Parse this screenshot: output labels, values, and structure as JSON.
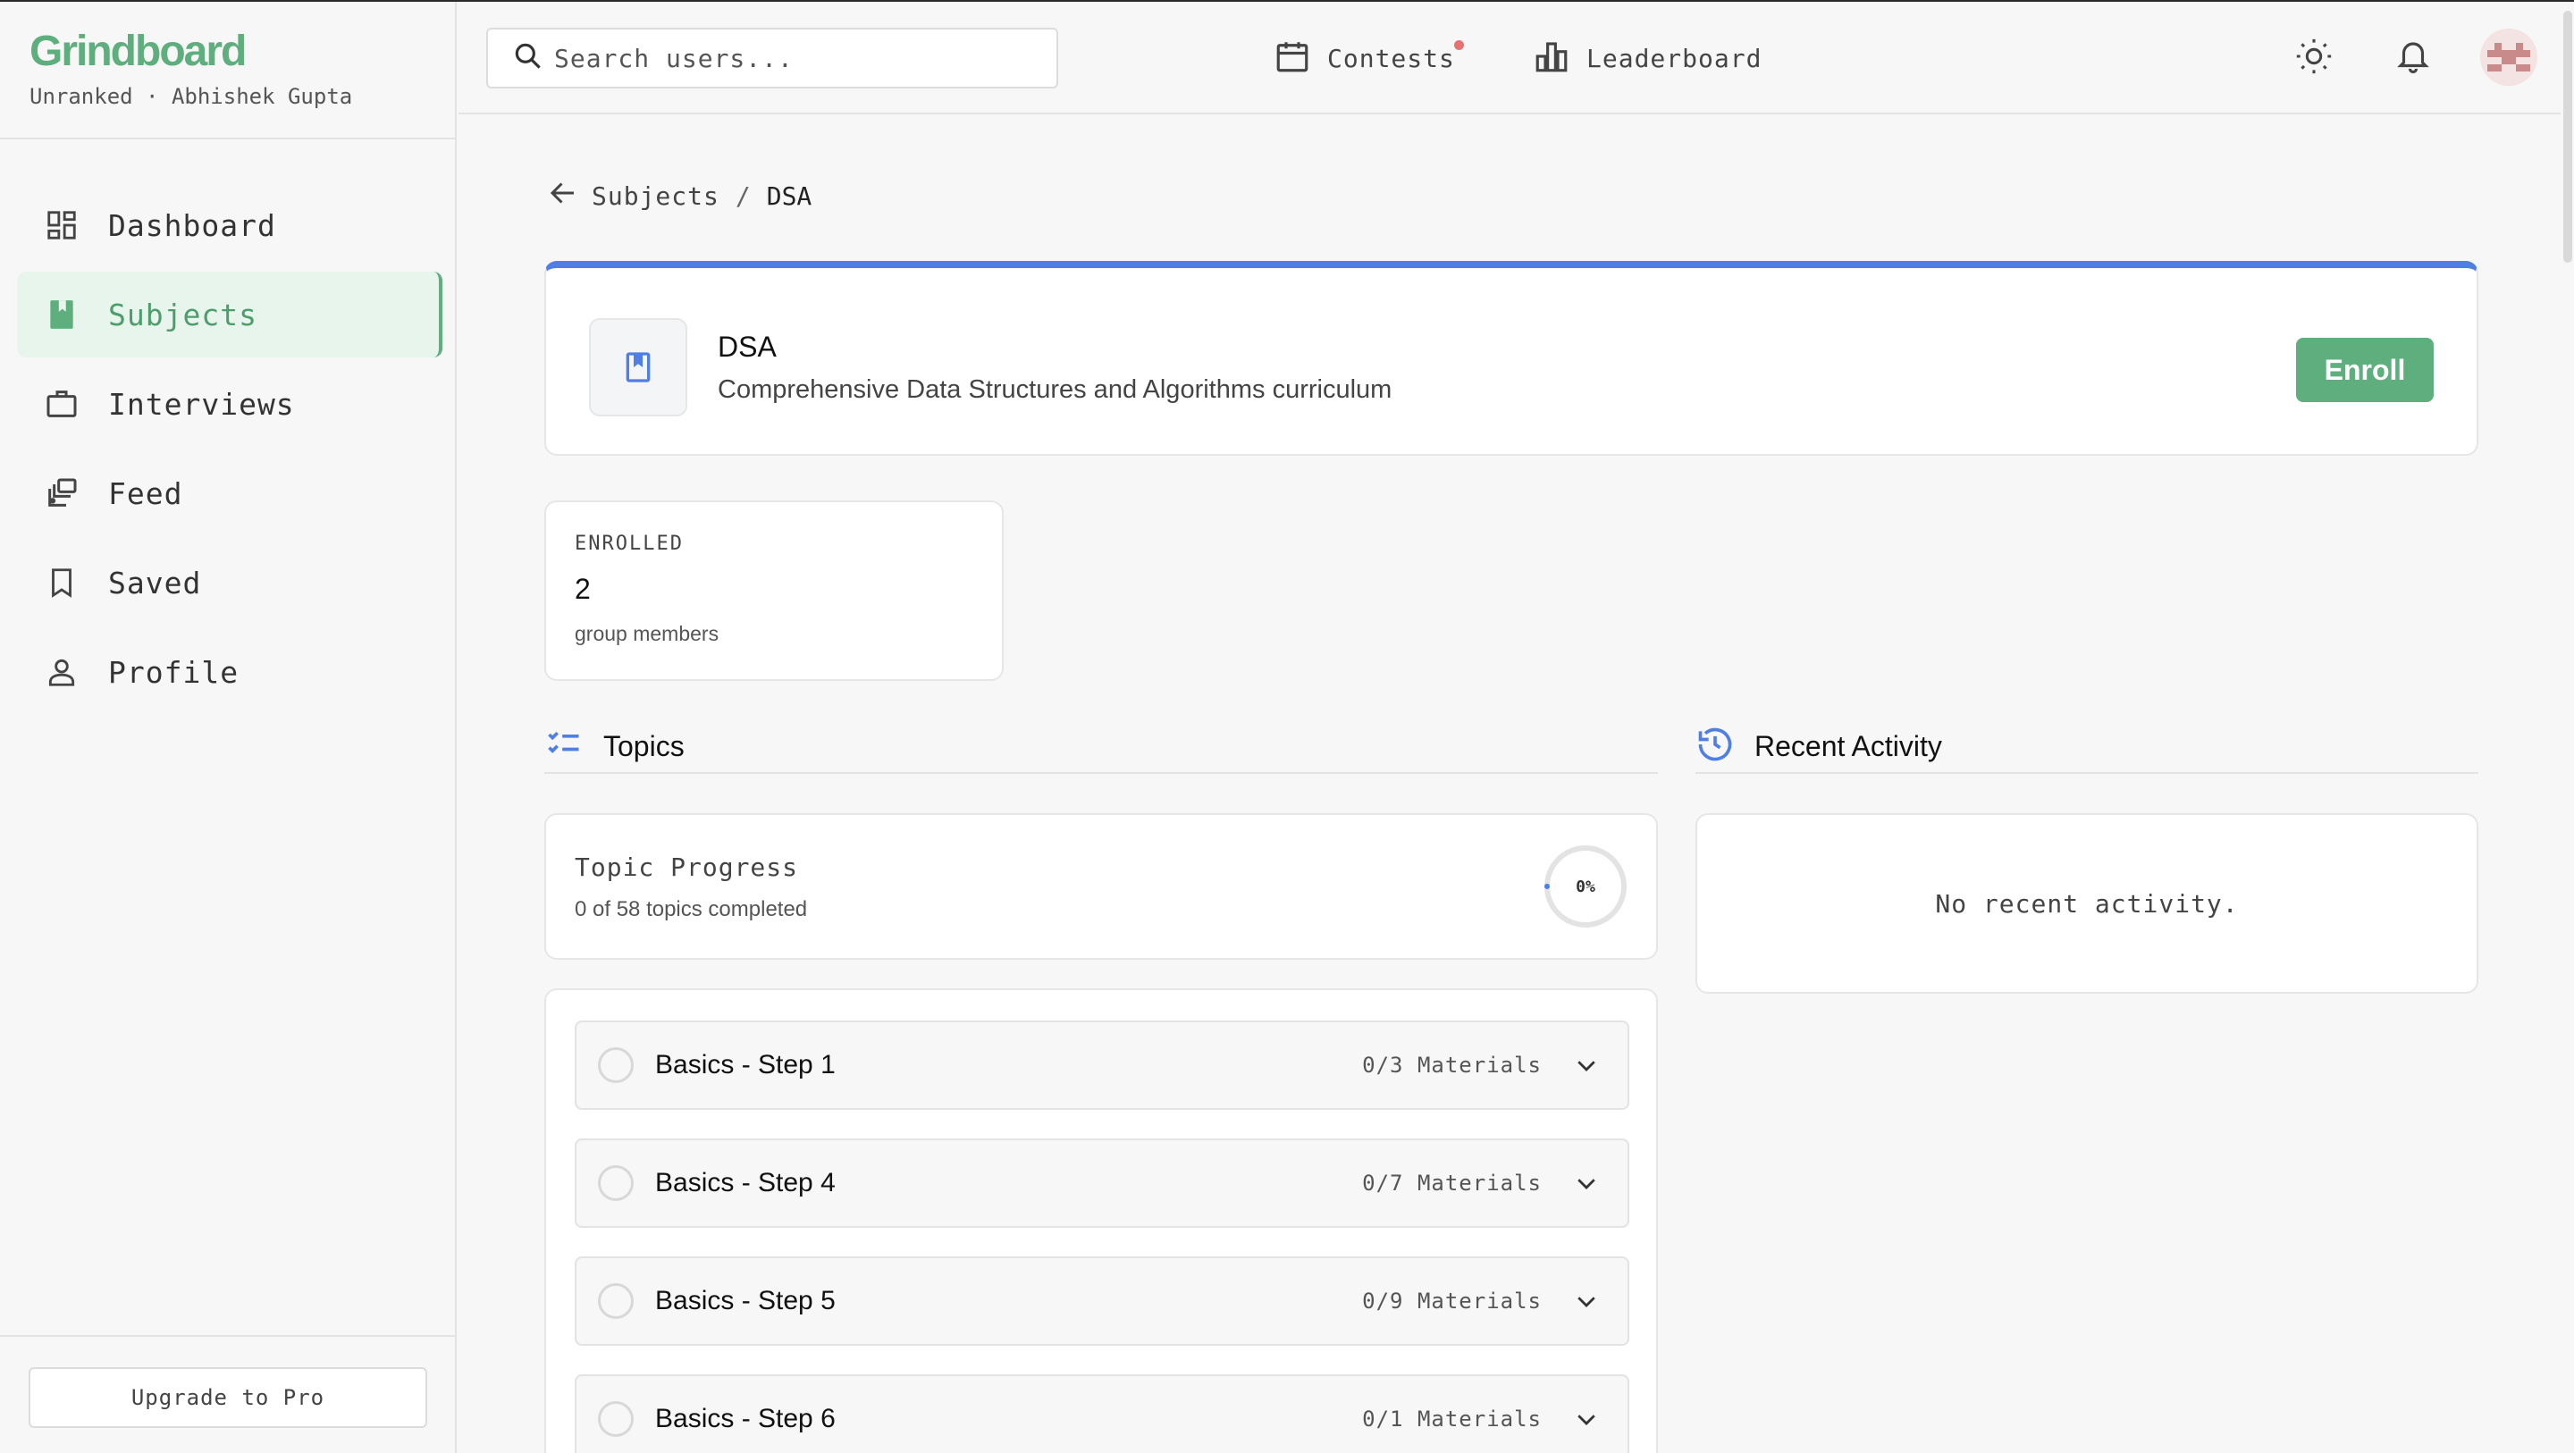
{
  "brand": {
    "name": "Grindboard",
    "subtitle": "Unranked · Abhishek Gupta"
  },
  "sidebar": {
    "items": [
      {
        "label": "Dashboard",
        "icon": "dashboard-icon"
      },
      {
        "label": "Subjects",
        "icon": "book-icon",
        "active": true
      },
      {
        "label": "Interviews",
        "icon": "briefcase-icon"
      },
      {
        "label": "Feed",
        "icon": "feed-icon"
      },
      {
        "label": "Saved",
        "icon": "bookmark-icon"
      },
      {
        "label": "Profile",
        "icon": "user-icon"
      }
    ],
    "upgrade_label": "Upgrade to Pro"
  },
  "topbar": {
    "search_placeholder": "Search users...",
    "contests_label": "Contests",
    "leaderboard_label": "Leaderboard"
  },
  "breadcrumb": {
    "parent": "Subjects",
    "separator": "/",
    "current": "DSA"
  },
  "subject": {
    "title": "DSA",
    "description": "Comprehensive Data Structures and Algorithms curriculum",
    "enroll_label": "Enroll"
  },
  "stat": {
    "label": "ENROLLED",
    "value": "2",
    "sub": "group members"
  },
  "topics": {
    "heading": "Topics",
    "progress_title": "Topic Progress",
    "progress_sub": "0 of 58 topics completed",
    "progress_percent_label": "0%",
    "progress_fraction": 0,
    "items": [
      {
        "name": "Basics - Step 1",
        "count": "0/3 Materials"
      },
      {
        "name": "Basics - Step 4",
        "count": "0/7 Materials"
      },
      {
        "name": "Basics - Step 5",
        "count": "0/9 Materials"
      },
      {
        "name": "Basics - Step 6",
        "count": "0/1 Materials"
      }
    ]
  },
  "activity": {
    "heading": "Recent Activity",
    "empty_text": "No recent activity."
  },
  "colors": {
    "accent_green": "#5fae7d",
    "accent_blue": "#4f7fe5",
    "notification_dot": "#e57373"
  }
}
